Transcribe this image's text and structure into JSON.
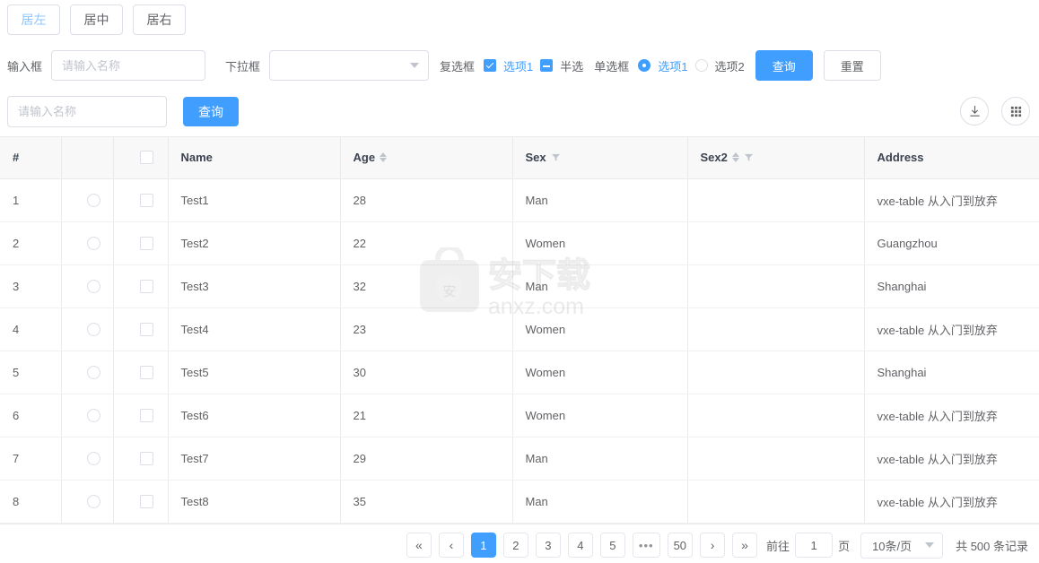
{
  "tabs": [
    {
      "label": "居左",
      "active": true
    },
    {
      "label": "居中",
      "active": false
    },
    {
      "label": "居右",
      "active": false
    }
  ],
  "form": {
    "input_label": "输入框",
    "input_value": "",
    "input_placeholder": "请输入名称",
    "select_label": "下拉框",
    "select_value": "",
    "checkbox_label": "复选框",
    "checkbox_1": "选项1",
    "checkbox_2": "半选",
    "radio_label": "单选框",
    "radio_1": "选项1",
    "radio_2": "选项2",
    "query_button": "查询",
    "reset_button": "重置"
  },
  "search": {
    "placeholder": "请输入名称",
    "value": "",
    "button": "查询",
    "export_icon": "download-icon",
    "columns_icon": "grid-icon"
  },
  "table": {
    "columns": [
      {
        "key": "seq",
        "label": "#",
        "sort": false,
        "filter": false
      },
      {
        "key": "radio",
        "label": "",
        "sort": false,
        "filter": false
      },
      {
        "key": "check",
        "label": "",
        "sort": false,
        "filter": false
      },
      {
        "key": "name",
        "label": "Name",
        "sort": false,
        "filter": false
      },
      {
        "key": "age",
        "label": "Age",
        "sort": true,
        "filter": false
      },
      {
        "key": "sex",
        "label": "Sex",
        "sort": false,
        "filter": true
      },
      {
        "key": "sex2",
        "label": "Sex2",
        "sort": true,
        "filter": true
      },
      {
        "key": "address",
        "label": "Address",
        "sort": false,
        "filter": false
      }
    ],
    "rows": [
      {
        "seq": "1",
        "name": "Test1",
        "age": "28",
        "sex": "Man",
        "sex2": "",
        "address": "vxe-table 从入门到放弃"
      },
      {
        "seq": "2",
        "name": "Test2",
        "age": "22",
        "sex": "Women",
        "sex2": "",
        "address": "Guangzhou"
      },
      {
        "seq": "3",
        "name": "Test3",
        "age": "32",
        "sex": "Man",
        "sex2": "",
        "address": "Shanghai"
      },
      {
        "seq": "4",
        "name": "Test4",
        "age": "23",
        "sex": "Women",
        "sex2": "",
        "address": "vxe-table 从入门到放弃"
      },
      {
        "seq": "5",
        "name": "Test5",
        "age": "30",
        "sex": "Women",
        "sex2": "",
        "address": "Shanghai"
      },
      {
        "seq": "6",
        "name": "Test6",
        "age": "21",
        "sex": "Women",
        "sex2": "",
        "address": "vxe-table 从入门到放弃"
      },
      {
        "seq": "7",
        "name": "Test7",
        "age": "29",
        "sex": "Man",
        "sex2": "",
        "address": "vxe-table 从入门到放弃"
      },
      {
        "seq": "8",
        "name": "Test8",
        "age": "35",
        "sex": "Man",
        "sex2": "",
        "address": "vxe-table 从入门到放弃"
      }
    ]
  },
  "pagination": {
    "first": "«",
    "prev": "‹",
    "pages": [
      "1",
      "2",
      "3",
      "4",
      "5"
    ],
    "ellipsis": "•••",
    "last_page": "50",
    "next": "›",
    "last": "»",
    "current": "1",
    "jump_prefix": "前往",
    "jump_value": "1",
    "jump_suffix": "页",
    "page_size": "10条/页",
    "total_text": "共 500 条记录"
  },
  "watermark": {
    "text": "anxz.com",
    "logo_text": "安",
    "brand": "安下载"
  },
  "colors": {
    "primary": "#409eff",
    "border": "#dcdfe6",
    "header_bg": "#f8f8f9",
    "text": "#606266"
  }
}
